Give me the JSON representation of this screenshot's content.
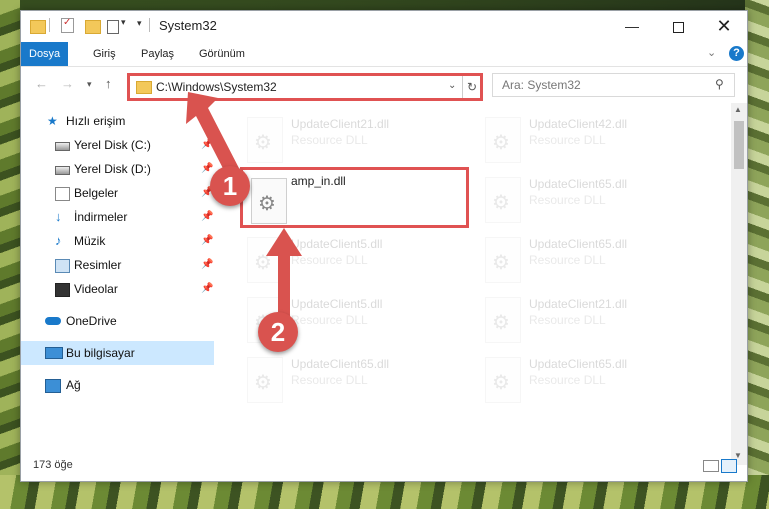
{
  "window": {
    "title": "System32",
    "controls": {
      "minimize": "—",
      "maximize": "",
      "close": "✕"
    }
  },
  "ribbon": {
    "tabs": [
      "Dosya",
      "Giriş",
      "Paylaş",
      "Görünüm"
    ],
    "help": "?"
  },
  "address": {
    "path": "C:\\Windows\\System32",
    "search_placeholder": "Ara: System32"
  },
  "sidebar": {
    "items": [
      {
        "label": "Hızlı erişim",
        "icon": "star-icon"
      },
      {
        "label": "Yerel Disk (C:)",
        "icon": "drive-icon",
        "pinned": true
      },
      {
        "label": "Yerel Disk (D:)",
        "icon": "drive-icon",
        "pinned": true
      },
      {
        "label": "Belgeler",
        "icon": "documents-icon",
        "pinned": true
      },
      {
        "label": "İndirmeler",
        "icon": "download-icon",
        "pinned": true
      },
      {
        "label": "Müzik",
        "icon": "music-icon",
        "pinned": true
      },
      {
        "label": "Resimler",
        "icon": "pictures-icon",
        "pinned": true
      },
      {
        "label": "Videolar",
        "icon": "videos-icon",
        "pinned": true
      },
      {
        "label": "OneDrive",
        "icon": "cloud-icon"
      },
      {
        "label": "Bu bilgisayar",
        "icon": "computer-icon",
        "selected": true
      },
      {
        "label": "Ağ",
        "icon": "network-icon"
      }
    ]
  },
  "files": {
    "highlighted": {
      "name": "amp_in.dll"
    },
    "left_column": [
      {
        "name": "UpdateClient21.dll",
        "type": "Resource DLL"
      },
      {
        "name": "UpdateClient5.dll",
        "type": "Resource DLL"
      },
      {
        "name": "UpdateClient5.dll",
        "type": "Resource DLL"
      },
      {
        "name": "UpdateClient65.dll",
        "type": "Resource DLL"
      }
    ],
    "right_column": [
      {
        "name": "UpdateClient42.dll",
        "type": "Resource DLL"
      },
      {
        "name": "UpdateClient65.dll",
        "type": "Resource DLL"
      },
      {
        "name": "UpdateClient65.dll",
        "type": "Resource DLL"
      },
      {
        "name": "UpdateClient21.dll",
        "type": "Resource DLL"
      },
      {
        "name": "UpdateClient65.dll",
        "type": "Resource DLL"
      }
    ]
  },
  "status": {
    "item_count": "173 öğe"
  },
  "annotations": {
    "step1": "1",
    "step2": "2",
    "color": "#d9534f"
  }
}
